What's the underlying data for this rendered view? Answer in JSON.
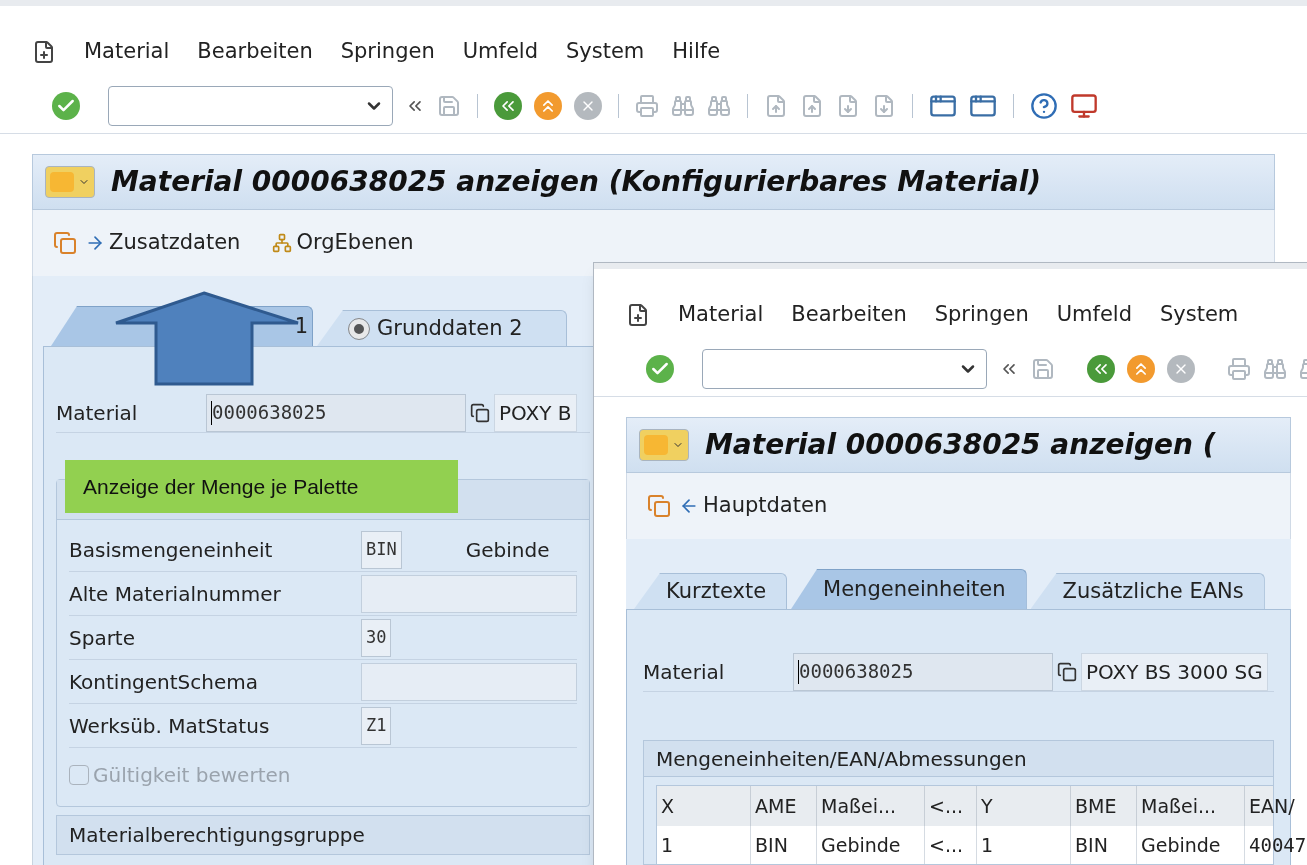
{
  "main_window": {
    "menu": [
      "Material",
      "Bearbeiten",
      "Springen",
      "Umfeld",
      "System",
      "Hilfe"
    ],
    "title": "Material 0000638025 anzeigen (Konfigurierbares Material)",
    "app_buttons": [
      {
        "label": "Zusatzdaten",
        "kind": "forward"
      },
      {
        "label": "OrgEbenen",
        "kind": "org"
      }
    ],
    "tabs": [
      {
        "label": "1",
        "selected": true
      },
      {
        "label": "Grunddaten 2",
        "selected": false
      }
    ],
    "material": {
      "label": "Material",
      "value": "0000638025",
      "description": "POXY B"
    },
    "group": {
      "fields": [
        {
          "label": "Basismengeneinheit",
          "value": "BIN",
          "note": "Gebinde",
          "kind": "short"
        },
        {
          "label": "Alte Materialnummer",
          "kind": "long"
        },
        {
          "label": "Sparte",
          "value": "30",
          "kind": "short"
        },
        {
          "label": "KontingentSchema",
          "kind": "long"
        },
        {
          "label": "Werksüb. MatStatus",
          "value": "Z1",
          "kind": "short"
        }
      ],
      "checkbox": {
        "label": "Gültigkeit bewerten",
        "checked": false,
        "disabled": true
      }
    },
    "group_2": {
      "title": "Materialberechtigungsgruppe"
    }
  },
  "annotation": {
    "text": "Anzeige der Menge je Palette"
  },
  "detail_window": {
    "menu": [
      "Material",
      "Bearbeiten",
      "Springen",
      "Umfeld",
      "System"
    ],
    "title": "Material 0000638025 anzeigen (",
    "app_buttons": [
      {
        "label": "Hauptdaten",
        "kind": "back"
      }
    ],
    "tabs": [
      {
        "label": "Kurztexte",
        "selected": false
      },
      {
        "label": "Mengeneinheiten",
        "selected": true
      },
      {
        "label": "Zusätzliche EANs",
        "selected": false
      }
    ],
    "material": {
      "label": "Material",
      "value": "0000638025",
      "description": "POXY BS 3000 SG"
    },
    "table": {
      "title": "Mengeneinheiten/EAN/Abmessungen",
      "columns": [
        "X",
        "AME",
        "Maßei...",
        "<...",
        "Y",
        "BME",
        "Maßei...",
        "EAN/"
      ],
      "rows": [
        [
          "1",
          "BIN",
          "Gebinde",
          "<...",
          "1",
          "BIN",
          "Gebinde",
          "40047"
        ]
      ]
    }
  }
}
